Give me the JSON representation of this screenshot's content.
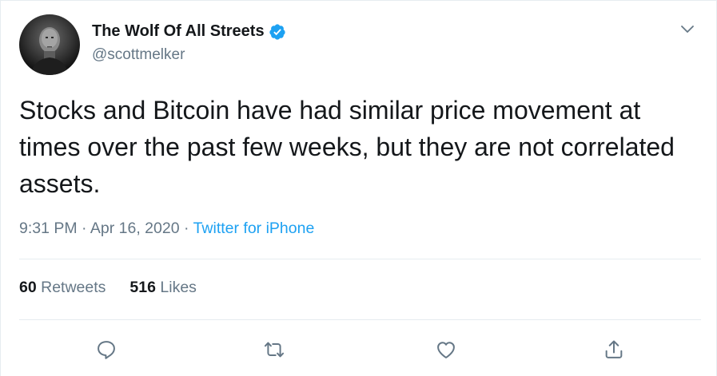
{
  "author": {
    "display_name": "The Wolf Of All Streets",
    "handle": "@scottmelker",
    "verified": true,
    "avatar_icon": "avatar-photo"
  },
  "tweet": {
    "text": "Stocks and Bitcoin have had similar price movement at times over the past few weeks, but they are not correlated assets.",
    "time": "9:31 PM",
    "separator": "·",
    "date": "Apr 16, 2020",
    "source": "Twitter for iPhone"
  },
  "stats": {
    "retweets_count": "60",
    "retweets_label": "Retweets",
    "likes_count": "516",
    "likes_label": "Likes"
  },
  "actions": [
    "reply-icon",
    "retweet-icon",
    "like-icon",
    "share-icon"
  ],
  "colors": {
    "text": "#14171a",
    "secondary": "#657786",
    "accent": "#1da1f2",
    "divider": "#e6ecf0"
  }
}
